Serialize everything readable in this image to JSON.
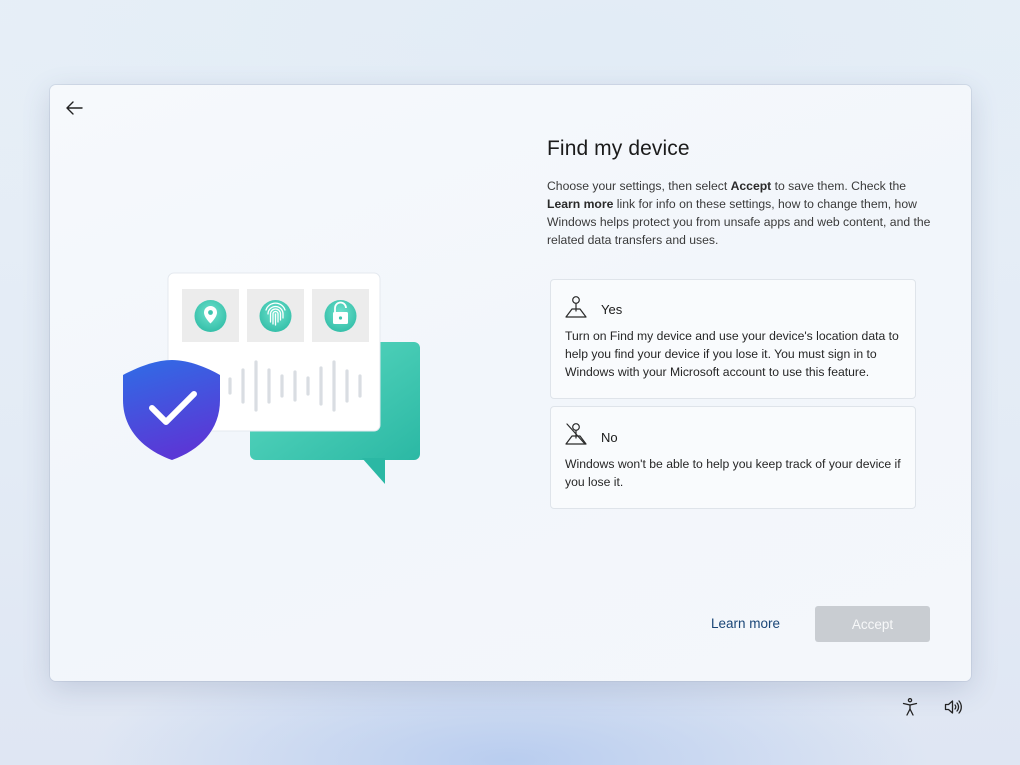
{
  "page": {
    "title": "Find my device",
    "description": {
      "p1": "Choose your settings, then select ",
      "accept_word": "Accept",
      "p2": " to save them. Check the ",
      "learn_more_word": "Learn more",
      "p3": " link for info on these settings, how to change them, how Windows helps protect you from unsafe apps and web content, and the related data transfers and uses."
    }
  },
  "options": [
    {
      "label": "Yes",
      "icon": "location-pin-icon",
      "text": "Turn on Find my device and use your device's location data to help you find your device if you lose it. You must sign in to Windows with your Microsoft account to use this feature."
    },
    {
      "label": "No",
      "icon": "location-off-icon",
      "text": "Windows won't be able to help you keep track of your device if you lose it."
    }
  ],
  "footer": {
    "learn_more": "Learn more",
    "accept": "Accept"
  },
  "icons": {
    "back": "back-arrow-icon",
    "accessibility": "accessibility-icon",
    "volume": "volume-icon"
  },
  "colors": {
    "accent_teal": "#3cc9b1",
    "shield_blue": "#3b5fe0",
    "accept_disabled": "#c9cdd2",
    "link": "#1a4677"
  }
}
